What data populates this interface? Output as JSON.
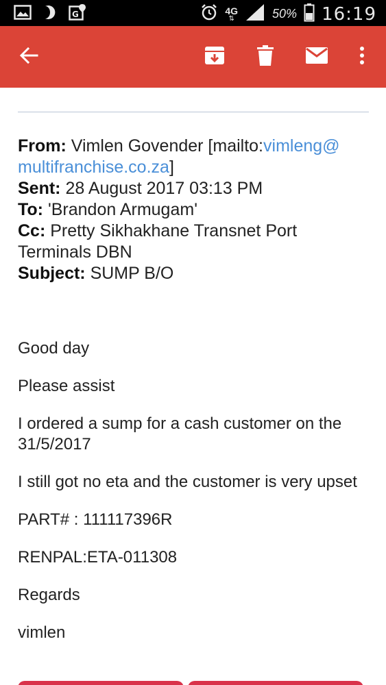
{
  "status_bar": {
    "network": "4G",
    "battery": "50%",
    "time": "16:19",
    "icons": [
      "gallery-icon",
      "moon-icon",
      "gmaps-icon",
      "alarm-icon",
      "signal-icon",
      "battery-icon"
    ]
  },
  "toolbar": {
    "back": "arrow-back-icon",
    "archive": "archive-icon",
    "delete": "trash-icon",
    "mark_unread": "mail-icon",
    "more": "more-vert-icon",
    "accent": "#db4437"
  },
  "email": {
    "from_label": "From:",
    "from_name": "Vimlen Govender [mailto:",
    "from_email_part1": "vimleng@",
    "from_email_part2": "multifranchise.co.za",
    "from_close": "]",
    "sent_label": "Sent:",
    "sent_value": "28 August 2017 03:13 PM",
    "to_label": "To:",
    "to_value": "'Brandon Armugam'",
    "cc_label": "Cc:",
    "cc_value": "Pretty Sikhakhane Transnet Port Terminals DBN",
    "subject_label": "Subject:",
    "subject_value": "SUMP B/O",
    "body": [
      "Good day",
      "Please assist",
      "I ordered a sump for a cash customer on the 31/5/2017",
      "I still got no eta and the customer is very upset",
      "PART# : 111117396R",
      "RENPAL:ETA-011308",
      "Regards",
      "vimlen"
    ]
  }
}
